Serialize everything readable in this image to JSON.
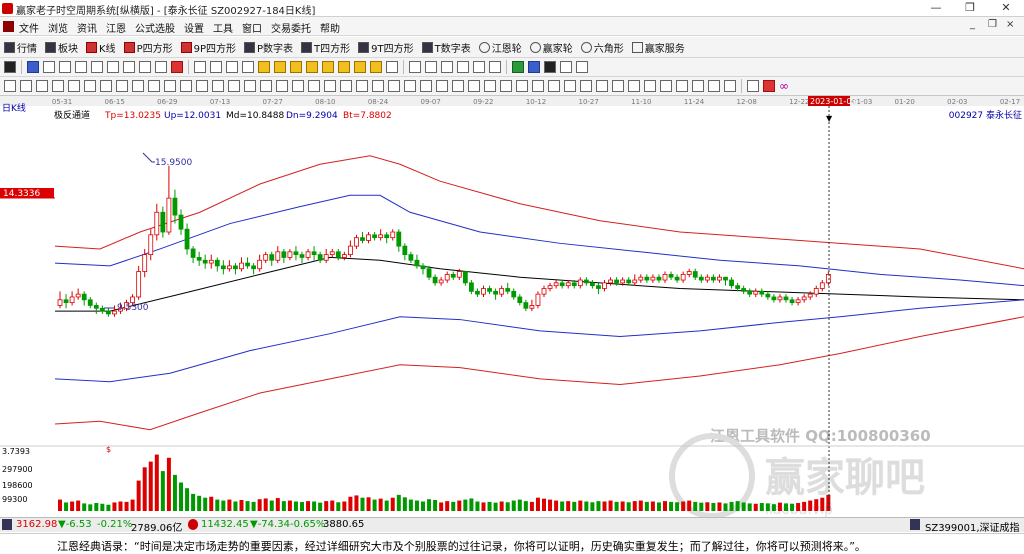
{
  "window": {
    "title": "赢家老子时空周期系统[纵横版] - [泰永长征  SZ002927-184日K线]",
    "min": "—",
    "restore": "❐",
    "close": "✕"
  },
  "menu": {
    "items": [
      "文件",
      "浏览",
      "资讯",
      "江恩",
      "公式选股",
      "设置",
      "工具",
      "窗口",
      "交易委托",
      "帮助"
    ],
    "mdi_min": "_",
    "mdi_restore": "❐",
    "mdi_close": "×"
  },
  "toolbar1": [
    "行情",
    "板块",
    "K线",
    "P四方形",
    "9P四方形",
    "P数字表",
    "T四方形",
    "9T四方形",
    "T数字表",
    "江恩轮",
    "赢家轮",
    "六角形",
    "赢家服务"
  ],
  "chart_header": {
    "period": "日K线",
    "indicator": "极反通道",
    "tp": "Tp=13.0235",
    "up": "Up=12.0031",
    "md": "Md=10.8488",
    "dn": "Dn=9.2904",
    "bt": "Bt=7.8802",
    "stock": "002927 泰永长征",
    "price_marker": "14.3336",
    "high_label": "15.9500",
    "low_label": "9.5300",
    "highlight_date": "2023-01-03"
  },
  "date_axis": [
    "05-31",
    "06-15",
    "06-29",
    "07-13",
    "07-27",
    "08-10",
    "08-24",
    "09-07",
    "09-22",
    "10-12",
    "10-27",
    "11-10",
    "11-24",
    "12-08",
    "12-22",
    "2023-01-03",
    "01-20",
    "02-03",
    "02-17"
  ],
  "volume_axis": [
    "3.7393",
    "297900",
    "198600",
    "99300"
  ],
  "watermark": {
    "line1": "江恩工具软件  QQ:100800360",
    "brand": "赢家聊吧",
    "url": "liaoba.vip"
  },
  "statusbar": {
    "sh_index": "3162.98",
    "sh_change": "▼-6.53",
    "sh_pct": "-0.21%",
    "sh_amount": "2789.06亿",
    "sz_index": "11432.45",
    "sz_change": "▼-74.34",
    "sz_pct": "-0.65%",
    "sz_amount": "3880.65",
    "right": "SZ399001,深证成指"
  },
  "quote": "江恩经典语录：“时间是决定市场走势的重要因素，经过详细研究大市及个别股票的过往记录，你将可以证明，历史确实重复发生；而了解过往，你将可以预测将来。”。",
  "colors": {
    "up": "#dd0000",
    "down": "#009900",
    "outer_channel": "#d42020",
    "inner_channel": "#2030c8",
    "mid_line": "#000000"
  },
  "chart_data": {
    "type": "candlestick",
    "x_range": [
      "2022-05-31",
      "2023-02-17"
    ],
    "y_range": [
      7.8802,
      15.95
    ],
    "candles": [
      [
        11.0,
        11.2,
        11.5,
        10.9
      ],
      [
        11.2,
        11.1,
        11.4,
        10.9
      ],
      [
        11.1,
        11.3,
        11.5,
        11.0
      ],
      [
        11.3,
        11.4,
        11.6,
        11.2
      ],
      [
        11.4,
        11.2,
        11.5,
        11.0
      ],
      [
        11.2,
        11.0,
        11.3,
        10.9
      ],
      [
        11.0,
        10.9,
        11.1,
        10.7
      ],
      [
        10.9,
        10.8,
        11.0,
        10.7
      ],
      [
        10.8,
        10.7,
        10.9,
        10.6
      ],
      [
        10.7,
        10.8,
        11.0,
        10.6
      ],
      [
        10.8,
        10.9,
        11.1,
        10.7
      ],
      [
        10.9,
        11.1,
        11.2,
        10.8
      ],
      [
        11.1,
        11.3,
        11.4,
        11.0
      ],
      [
        11.3,
        12.2,
        12.4,
        11.2
      ],
      [
        12.2,
        12.8,
        13.0,
        12.0
      ],
      [
        12.8,
        13.5,
        13.7,
        12.6
      ],
      [
        13.5,
        14.3,
        14.6,
        13.3
      ],
      [
        14.3,
        13.6,
        14.5,
        13.4
      ],
      [
        13.6,
        14.8,
        15.95,
        13.5
      ],
      [
        14.8,
        14.2,
        15.1,
        13.9
      ],
      [
        14.2,
        13.7,
        14.4,
        13.5
      ],
      [
        13.7,
        13.0,
        13.9,
        12.8
      ],
      [
        13.0,
        12.7,
        13.1,
        12.5
      ],
      [
        12.7,
        12.6,
        12.9,
        12.4
      ],
      [
        12.6,
        12.5,
        12.8,
        12.3
      ],
      [
        12.5,
        12.6,
        12.8,
        12.3
      ],
      [
        12.6,
        12.4,
        12.7,
        12.2
      ],
      [
        12.4,
        12.3,
        12.6,
        12.1
      ],
      [
        12.3,
        12.4,
        12.6,
        12.2
      ],
      [
        12.4,
        12.3,
        12.5,
        12.1
      ],
      [
        12.3,
        12.5,
        12.7,
        12.2
      ],
      [
        12.5,
        12.4,
        12.7,
        12.3
      ],
      [
        12.4,
        12.3,
        12.5,
        12.1
      ],
      [
        12.3,
        12.6,
        12.8,
        12.2
      ],
      [
        12.6,
        12.8,
        12.9,
        12.5
      ],
      [
        12.8,
        12.6,
        12.9,
        12.4
      ],
      [
        12.6,
        12.9,
        13.1,
        12.5
      ],
      [
        12.9,
        12.7,
        13.0,
        12.5
      ],
      [
        12.7,
        12.9,
        13.0,
        12.6
      ],
      [
        12.9,
        12.8,
        13.1,
        12.6
      ],
      [
        12.8,
        12.7,
        12.9,
        12.5
      ],
      [
        12.7,
        12.9,
        13.0,
        12.6
      ],
      [
        12.9,
        12.8,
        13.1,
        12.6
      ],
      [
        12.8,
        12.6,
        12.9,
        12.5
      ],
      [
        12.6,
        12.8,
        13.0,
        12.5
      ],
      [
        12.8,
        12.9,
        13.0,
        12.7
      ],
      [
        12.9,
        12.7,
        13.0,
        12.6
      ],
      [
        12.7,
        12.8,
        12.9,
        12.6
      ],
      [
        12.8,
        13.1,
        13.3,
        12.7
      ],
      [
        13.1,
        13.4,
        13.5,
        13.0
      ],
      [
        13.4,
        13.3,
        13.6,
        13.2
      ],
      [
        13.3,
        13.5,
        13.6,
        13.2
      ],
      [
        13.5,
        13.4,
        13.6,
        13.3
      ],
      [
        13.4,
        13.5,
        13.7,
        13.3
      ],
      [
        13.5,
        13.4,
        13.6,
        13.2
      ],
      [
        13.4,
        13.6,
        13.7,
        13.3
      ],
      [
        13.6,
        13.1,
        13.7,
        12.9
      ],
      [
        13.1,
        12.8,
        13.2,
        12.6
      ],
      [
        12.8,
        12.6,
        12.9,
        12.5
      ],
      [
        12.6,
        12.4,
        12.8,
        12.3
      ],
      [
        12.4,
        12.3,
        12.5,
        12.1
      ],
      [
        12.3,
        12.0,
        12.4,
        11.9
      ],
      [
        12.0,
        11.8,
        12.1,
        11.7
      ],
      [
        11.8,
        11.9,
        12.0,
        11.7
      ],
      [
        11.9,
        12.1,
        12.2,
        11.8
      ],
      [
        12.1,
        12.0,
        12.2,
        11.9
      ],
      [
        12.0,
        12.2,
        12.3,
        11.9
      ],
      [
        12.2,
        11.8,
        12.2,
        11.7
      ],
      [
        11.8,
        11.5,
        11.9,
        11.4
      ],
      [
        11.5,
        11.4,
        11.6,
        11.3
      ],
      [
        11.4,
        11.6,
        11.7,
        11.3
      ],
      [
        11.6,
        11.5,
        11.7,
        11.4
      ],
      [
        11.5,
        11.4,
        11.6,
        11.2
      ],
      [
        11.4,
        11.6,
        11.7,
        11.3
      ],
      [
        11.6,
        11.5,
        11.8,
        11.4
      ],
      [
        11.5,
        11.3,
        11.6,
        11.2
      ],
      [
        11.3,
        11.1,
        11.4,
        11.0
      ],
      [
        11.1,
        10.9,
        11.2,
        10.8
      ],
      [
        10.9,
        11.0,
        11.2,
        10.8
      ],
      [
        11.0,
        11.4,
        11.5,
        10.9
      ],
      [
        11.4,
        11.6,
        11.7,
        11.3
      ],
      [
        11.6,
        11.7,
        11.8,
        11.5
      ],
      [
        11.7,
        11.8,
        11.9,
        11.6
      ],
      [
        11.8,
        11.7,
        11.9,
        11.6
      ],
      [
        11.7,
        11.8,
        11.9,
        11.6
      ],
      [
        11.8,
        11.7,
        11.9,
        11.6
      ],
      [
        11.7,
        11.9,
        12.0,
        11.6
      ],
      [
        11.9,
        11.8,
        12.0,
        11.7
      ],
      [
        11.8,
        11.7,
        11.9,
        11.6
      ],
      [
        11.7,
        11.6,
        11.8,
        11.4
      ],
      [
        11.6,
        11.8,
        11.9,
        11.5
      ],
      [
        11.8,
        11.9,
        12.0,
        11.7
      ],
      [
        11.9,
        11.8,
        12.0,
        11.7
      ],
      [
        11.8,
        11.9,
        12.0,
        11.7
      ],
      [
        11.9,
        11.8,
        12.0,
        11.7
      ],
      [
        11.8,
        11.9,
        12.1,
        11.7
      ],
      [
        11.9,
        12.0,
        12.1,
        11.8
      ],
      [
        12.0,
        11.9,
        12.1,
        11.8
      ],
      [
        11.9,
        12.0,
        12.1,
        11.8
      ],
      [
        12.0,
        11.9,
        12.1,
        11.8
      ],
      [
        11.9,
        12.1,
        12.2,
        11.8
      ],
      [
        12.1,
        12.0,
        12.2,
        11.9
      ],
      [
        12.0,
        11.9,
        12.1,
        11.8
      ],
      [
        11.9,
        12.1,
        12.2,
        11.8
      ],
      [
        12.1,
        12.2,
        12.3,
        12.0
      ],
      [
        12.2,
        12.0,
        12.3,
        11.9
      ],
      [
        12.0,
        11.9,
        12.1,
        11.8
      ],
      [
        11.9,
        12.0,
        12.1,
        11.8
      ],
      [
        12.0,
        11.9,
        12.1,
        11.8
      ],
      [
        11.9,
        12.0,
        12.1,
        11.8
      ],
      [
        12.0,
        11.9,
        12.0,
        11.7
      ],
      [
        11.9,
        11.7,
        12.0,
        11.6
      ],
      [
        11.7,
        11.6,
        11.8,
        11.5
      ],
      [
        11.6,
        11.5,
        11.7,
        11.4
      ],
      [
        11.5,
        11.4,
        11.6,
        11.3
      ],
      [
        11.4,
        11.5,
        11.6,
        11.3
      ],
      [
        11.5,
        11.4,
        11.6,
        11.3
      ],
      [
        11.4,
        11.3,
        11.5,
        11.2
      ],
      [
        11.3,
        11.2,
        11.4,
        11.1
      ],
      [
        11.2,
        11.3,
        11.4,
        11.1
      ],
      [
        11.3,
        11.2,
        11.4,
        11.1
      ],
      [
        11.2,
        11.1,
        11.3,
        11.0
      ],
      [
        11.1,
        11.2,
        11.3,
        11.0
      ],
      [
        11.2,
        11.3,
        11.4,
        11.1
      ],
      [
        11.3,
        11.4,
        11.5,
        11.2
      ],
      [
        11.4,
        11.6,
        11.7,
        11.3
      ],
      [
        11.6,
        11.8,
        11.9,
        11.5
      ],
      [
        11.8,
        12.1,
        12.2,
        11.7
      ]
    ],
    "volume_max": 297900,
    "volumes": [
      60,
      45,
      50,
      55,
      40,
      35,
      42,
      38,
      33,
      45,
      50,
      48,
      60,
      160,
      230,
      260,
      297,
      210,
      280,
      190,
      150,
      120,
      90,
      80,
      70,
      75,
      60,
      55,
      60,
      50,
      58,
      52,
      48,
      62,
      66,
      55,
      68,
      52,
      55,
      50,
      47,
      52,
      50,
      44,
      52,
      55,
      46,
      50,
      75,
      82,
      70,
      72,
      60,
      65,
      55,
      70,
      85,
      72,
      60,
      55,
      50,
      62,
      58,
      45,
      52,
      48,
      55,
      60,
      66,
      50,
      45,
      48,
      44,
      50,
      46,
      55,
      60,
      52,
      48,
      70,
      65,
      60,
      55,
      50,
      52,
      48,
      55,
      50,
      46,
      52,
      50,
      55,
      48,
      50,
      46,
      52,
      55,
      48,
      50,
      45,
      52,
      48,
      46,
      50,
      55,
      48,
      44,
      46,
      42,
      45,
      40,
      48,
      52,
      45,
      40,
      38,
      42,
      40,
      36,
      44,
      40,
      38,
      42,
      48,
      55,
      62,
      70,
      85
    ]
  }
}
